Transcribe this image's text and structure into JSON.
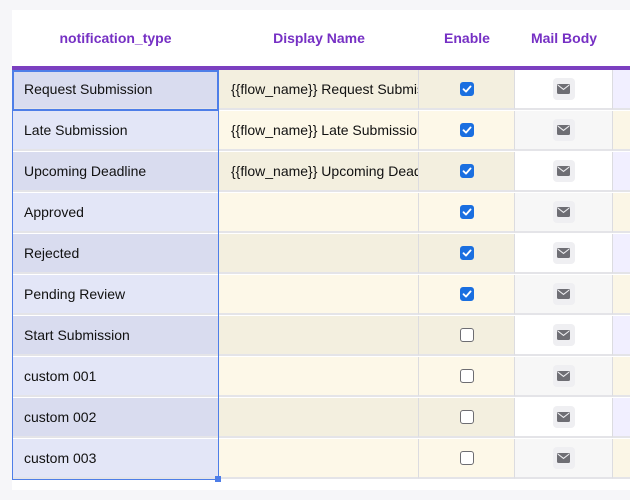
{
  "columns": {
    "type": "notification_type",
    "display": "Display Name",
    "enable": "Enable",
    "mail": "Mail Body"
  },
  "icons": {
    "checkbox": "checkbox-check-icon",
    "mail": "envelope-icon"
  },
  "colors": {
    "header_text": "#7630c4",
    "header_rule": "#7b3fc0",
    "selection": "#4e7ee8",
    "checkbox_on": "#1a6fe0"
  },
  "rows": [
    {
      "type": "Request Submission",
      "display": "{{flow_name}} Request Submission",
      "enabled": true
    },
    {
      "type": "Late Submission",
      "display": "{{flow_name}} Late Submission",
      "enabled": true
    },
    {
      "type": "Upcoming Deadline",
      "display": "{{flow_name}} Upcoming Deadline",
      "enabled": true
    },
    {
      "type": "Approved",
      "display": "",
      "enabled": true
    },
    {
      "type": "Rejected",
      "display": "",
      "enabled": true
    },
    {
      "type": "Pending Review",
      "display": "",
      "enabled": true
    },
    {
      "type": "Start Submission",
      "display": "",
      "enabled": false
    },
    {
      "type": "custom 001",
      "display": "",
      "enabled": false
    },
    {
      "type": "custom 002",
      "display": "",
      "enabled": false
    },
    {
      "type": "custom 003",
      "display": "",
      "enabled": false
    }
  ]
}
